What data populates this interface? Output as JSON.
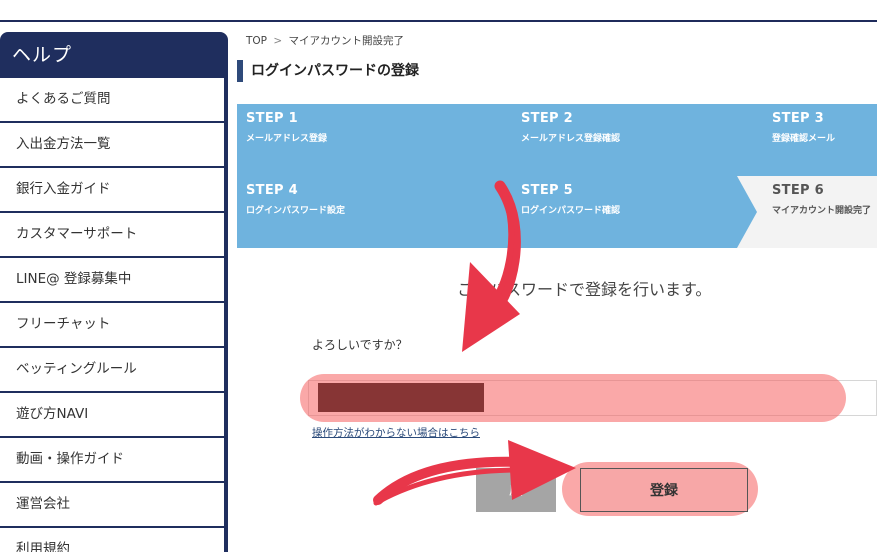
{
  "sidebar": {
    "title": "ヘルプ",
    "items": [
      {
        "label": "よくあるご質問"
      },
      {
        "label": "入出金方法一覧"
      },
      {
        "label": "銀行入金ガイド"
      },
      {
        "label": "カスタマーサポート"
      },
      {
        "label": "LINE@ 登録募集中"
      },
      {
        "label": "フリーチャット"
      },
      {
        "label": "ベッティングルール"
      },
      {
        "label": "遊び方NAVI"
      },
      {
        "label": "動画・操作ガイド"
      },
      {
        "label": "運営会社"
      },
      {
        "label": "利用規約"
      }
    ]
  },
  "breadcrumb": {
    "home": "TOP",
    "separator": ">",
    "current": "マイアカウント開設完了"
  },
  "page_title": "ログインパスワードの登録",
  "steps": [
    {
      "num": "STEP 1",
      "label": "メールアドレス登録"
    },
    {
      "num": "STEP 2",
      "label": "メールアドレス登録確認"
    },
    {
      "num": "STEP 3",
      "label": "登録確認メール"
    },
    {
      "num": "STEP 4",
      "label": "ログインパスワード設定"
    },
    {
      "num": "STEP 5",
      "label": "ログインパスワード確認"
    },
    {
      "num": "STEP 6",
      "label": "マイアカウント開設完了"
    }
  ],
  "current_step": 6,
  "confirm_text": "このパスワードで登録を行います。",
  "question": "よろしいですか？",
  "help_link": "操作方法がわからない場合はこちら",
  "buttons": {
    "back_label": "戻",
    "register_label": "登録"
  },
  "colors": {
    "sidebar_bg": "#1f2e5e",
    "steps_bg": "#6fb3de",
    "annotation_red": "#e8374a",
    "highlight": "#f56060"
  }
}
